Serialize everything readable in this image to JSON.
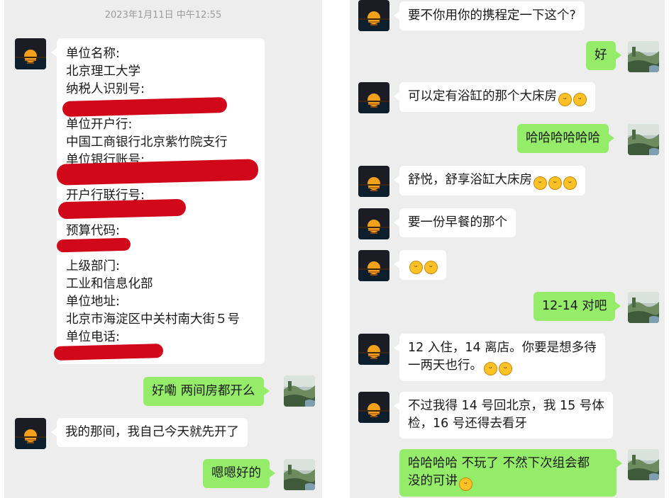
{
  "left": {
    "timestamp": "2023年1月11日 中午12:55",
    "info_lines": [
      "单位名称:",
      "北京理工大学",
      "纳税人识别号:",
      "",
      "单位开户行:",
      "中国工商银行北京紫竹院支行",
      "单位银行账号:",
      "",
      "开户行联行号:",
      "",
      "预算代码:",
      "",
      "上级部门:",
      "工业和信息化部",
      "单位地址:",
      "北京市海淀区中关村南大街５号",
      "单位电话:"
    ],
    "msg_green_1": "好嘞 两间房都开么",
    "msg_white_1": "我的那间，我自己今天就先开了",
    "msg_green_2": "嗯嗯好的"
  },
  "right": {
    "m1": "要不你用你的携程定一下这个?",
    "m2": "好",
    "m3": "可以定有浴缸的那个大床房",
    "m4": "哈哈哈哈哈哈",
    "m5": "舒悦，舒享浴缸大床房",
    "m6": "要一份早餐的那个",
    "m8": "12-14 对吧",
    "m9_line1": "12 入住，14 离店。你要是想多待",
    "m9_line2": "一两天也行。",
    "m10_line1": "不过我得 14 号回北京，我 15 号体",
    "m10_line2": "检，16 号还得去看牙",
    "m11_line1": "哈哈哈哈 不玩了 不然下次组会都",
    "m11_line2": "没的可讲"
  },
  "colors": {
    "chat_bg": "#ededed",
    "bubble_green": "#95ec69",
    "bubble_white": "#ffffff",
    "redaction_red": "#d0081a"
  },
  "icons": {
    "grin_emoji": "grinning-face-emoji",
    "laugh_emoji": "laughing-face-emoji"
  }
}
